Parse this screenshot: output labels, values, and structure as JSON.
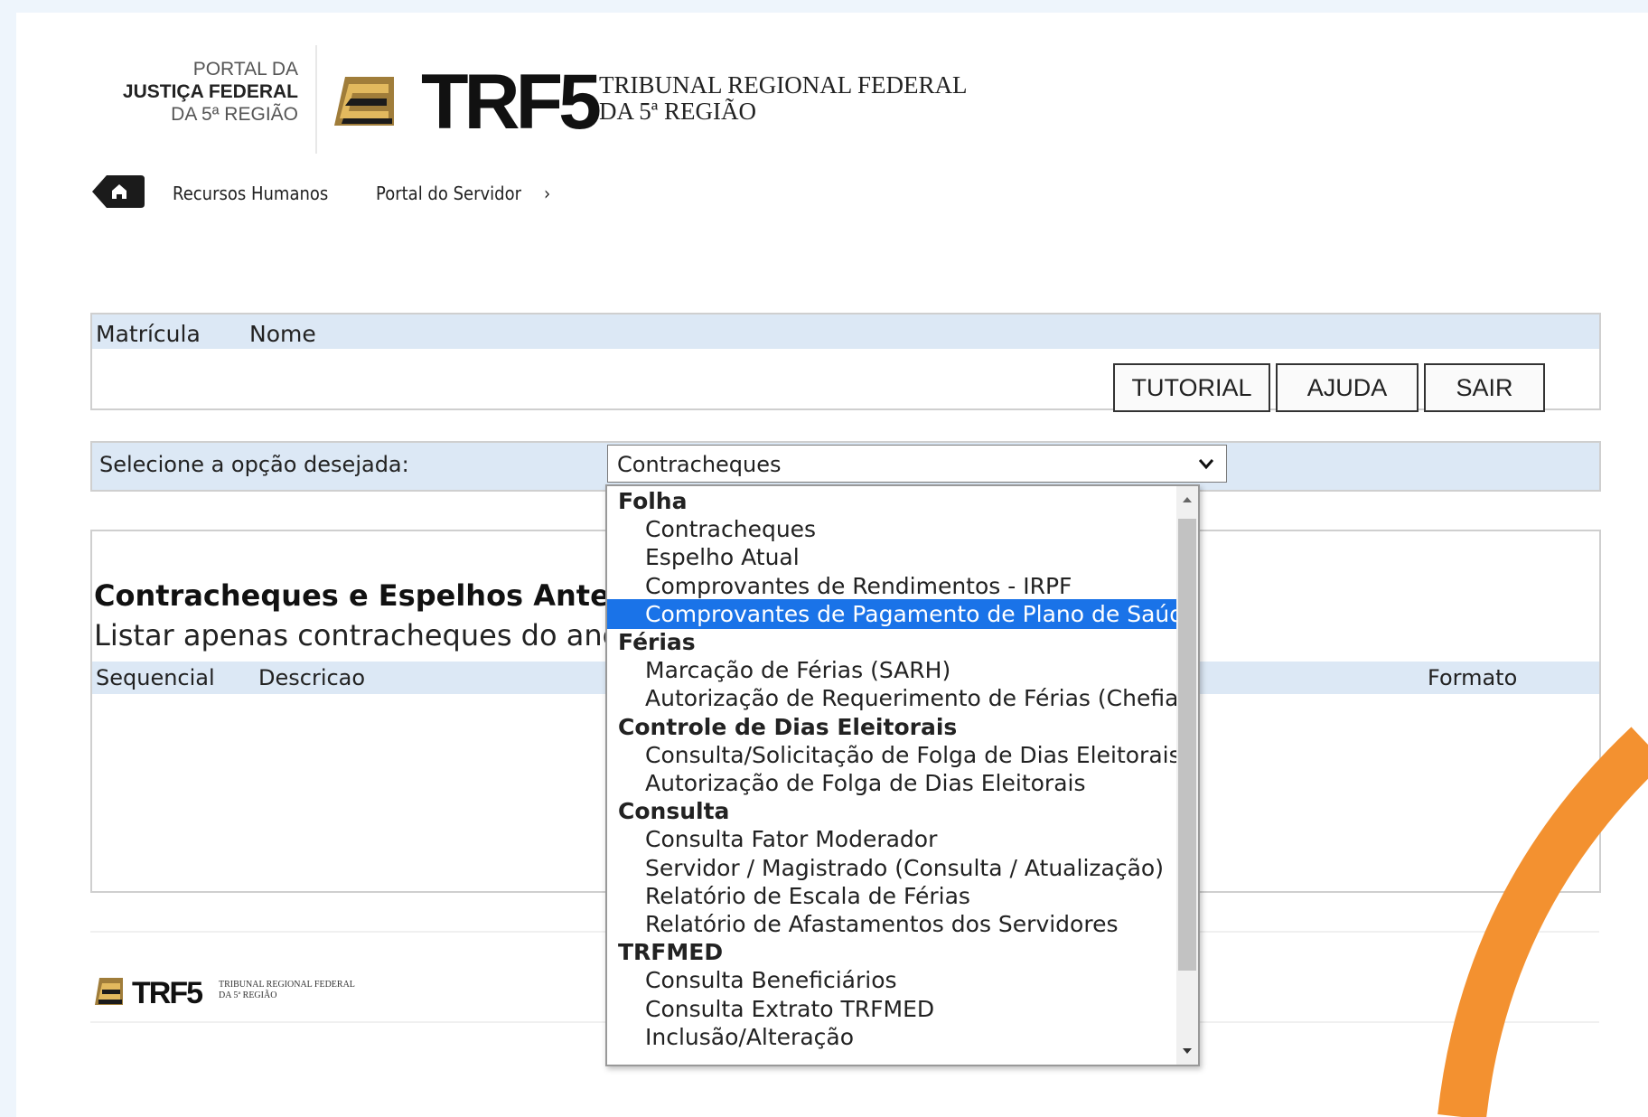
{
  "header": {
    "portal_line1": "PORTAL DA",
    "portal_line2": "JUSTIÇA FEDERAL",
    "portal_line3": "DA 5ª REGIÃO",
    "logo_text": "TRF5",
    "tribunal_line1": "TRIBUNAL REGIONAL FEDERAL",
    "tribunal_line2": "DA 5ª REGIÃO"
  },
  "breadcrumb": {
    "items": [
      "Recursos Humanos",
      "Portal do Servidor"
    ],
    "separator": "›"
  },
  "user_panel": {
    "matricula_label": "Matrícula",
    "nome_label": "Nome",
    "buttons": {
      "tutorial": "TUTORIAL",
      "ajuda": "AJUDA",
      "sair": "SAIR"
    }
  },
  "selector": {
    "label": "Selecione a opção desejada:",
    "value": "Contracheques"
  },
  "contracheques": {
    "title": "Contracheques e Espelhos Anterio",
    "subtitle": "Listar apenas contracheques do ano de",
    "columns": [
      "Sequencial",
      "Descricao",
      "Formato"
    ]
  },
  "dropdown": {
    "options": [
      {
        "label": "Folha",
        "group": true
      },
      {
        "label": "Contracheques",
        "group": false
      },
      {
        "label": "Espelho Atual",
        "group": false
      },
      {
        "label": "Comprovantes de Rendimentos - IRPF",
        "group": false
      },
      {
        "label": "Comprovantes de Pagamento de Plano de Saúde",
        "group": false,
        "selected": true
      },
      {
        "label": "Férias",
        "group": true
      },
      {
        "label": "Marcação de Férias (SARH)",
        "group": false
      },
      {
        "label": "Autorização de Requerimento de Férias (Chefia)",
        "group": false
      },
      {
        "label": "Controle de Dias Eleitorais",
        "group": true
      },
      {
        "label": "Consulta/Solicitação de Folga de Dias Eleitorais",
        "group": false
      },
      {
        "label": "Autorização de Folga de Dias Eleitorais",
        "group": false
      },
      {
        "label": "Consulta",
        "group": true
      },
      {
        "label": "Consulta Fator Moderador",
        "group": false
      },
      {
        "label": "Servidor / Magistrado (Consulta / Atualização)",
        "group": false
      },
      {
        "label": "Relatório de Escala de Férias",
        "group": false
      },
      {
        "label": "Relatório de Afastamentos dos Servidores",
        "group": false
      },
      {
        "label": "TRFMED",
        "group": true
      },
      {
        "label": "Consulta Beneficiários",
        "group": false
      },
      {
        "label": "Consulta Extrato TRFMED",
        "group": false
      },
      {
        "label": "Inclusão/Alteração",
        "group": false
      }
    ]
  },
  "footer": {
    "logo_text": "TRF5",
    "tribunal_line1": "TRIBUNAL REGIONAL FEDERAL",
    "tribunal_line2": "DA 5ª REGIÃO"
  },
  "colors": {
    "header_band": "#dce8f5",
    "selected_option": "#1a73e8",
    "accent_orange": "#f39130",
    "page_bg": "#eef5fc"
  },
  "icons": [
    "home-icon",
    "chevron-down-icon",
    "scroll-up-icon",
    "scroll-down-icon",
    "trf5-logo-mark"
  ]
}
